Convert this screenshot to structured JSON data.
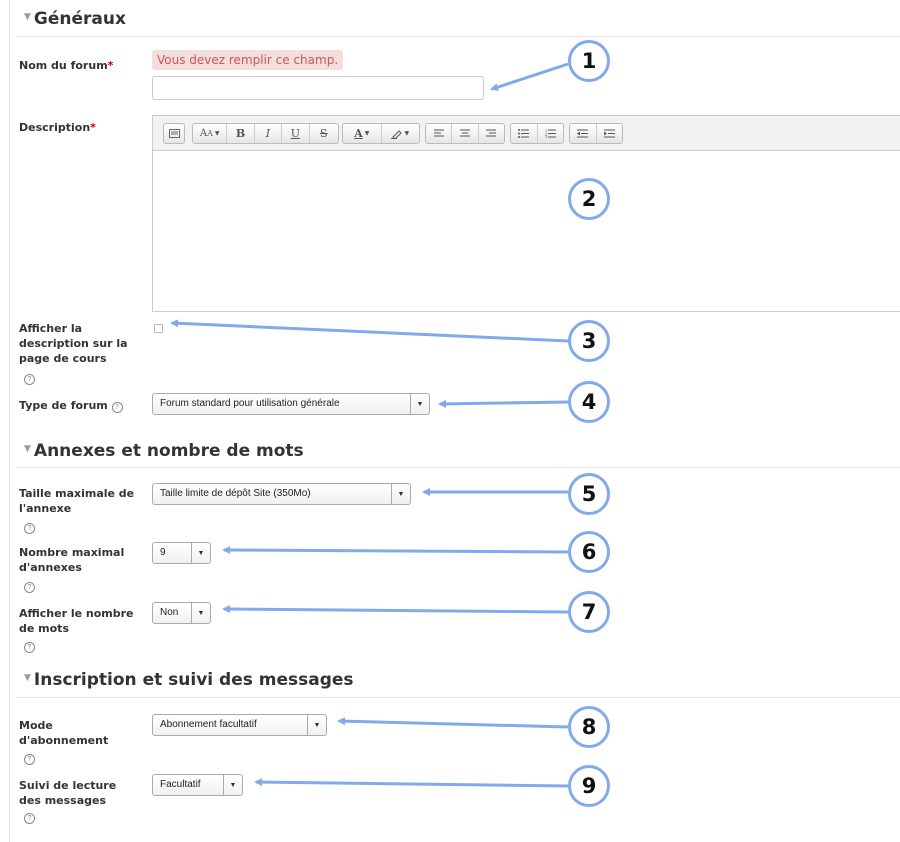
{
  "sections": {
    "general": "Généraux",
    "attachments": "Annexes et nombre de mots",
    "subscription": "Inscription et suivi des messages"
  },
  "fields": {
    "forum_name": {
      "label": "Nom du forum",
      "required": "*",
      "error": "Vous devez remplir ce champ.",
      "value": ""
    },
    "description": {
      "label": "Description",
      "required": "*"
    },
    "show_description": {
      "label": "Afficher la description sur la page de cours",
      "checked": false
    },
    "forum_type": {
      "label": "Type de forum",
      "value": "Forum standard pour utilisation générale"
    },
    "max_attachment_size": {
      "label": "Taille maximale de l'annexe",
      "value": "Taille limite de dépôt Site (350Mo)"
    },
    "max_attachments": {
      "label": "Nombre maximal d'annexes",
      "value": "9"
    },
    "show_word_count": {
      "label": "Afficher le nombre de mots",
      "value": "Non"
    },
    "subscription_mode": {
      "label": "Mode d'abonnement",
      "value": "Abonnement facultatif"
    },
    "read_tracking": {
      "label": "Suivi de lecture des messages",
      "value": "Facultatif"
    }
  },
  "toolbar_icons": [
    "toggle-toolbar-icon",
    "font-style-icon",
    "bold-icon",
    "italic-icon",
    "underline-icon",
    "strikethrough-icon",
    "font-color-icon",
    "background-color-icon",
    "align-left-icon",
    "align-center-icon",
    "align-right-icon",
    "unordered-list-icon",
    "ordered-list-icon",
    "outdent-icon",
    "indent-icon"
  ],
  "toolbar": {
    "bold": "B",
    "italic": "I",
    "underline": "U",
    "strike": "S",
    "font": "A",
    "color": "A"
  },
  "help_glyph": "?",
  "callouts": [
    "1",
    "2",
    "3",
    "4",
    "5",
    "6",
    "7",
    "8",
    "9"
  ],
  "colors": {
    "callout": "#82aaea",
    "required": "#cc0000",
    "error_bg": "#f2dede"
  }
}
